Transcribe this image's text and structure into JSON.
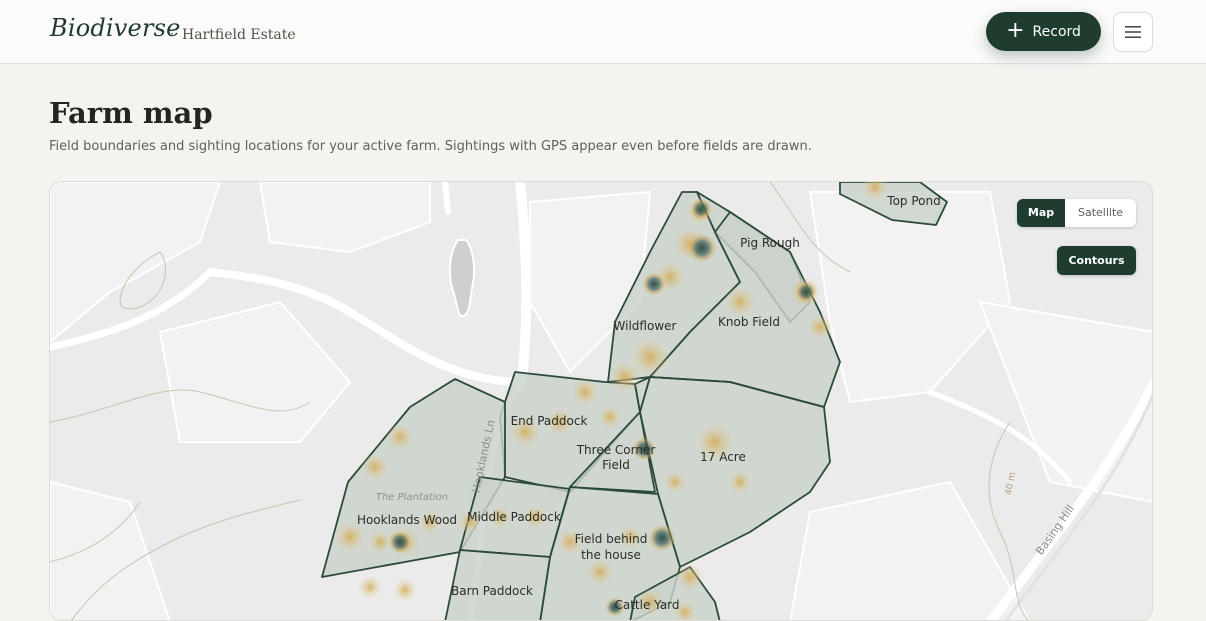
{
  "header": {
    "logo": "Biodiverse",
    "separator": "·",
    "farm_name": "Hartfield Estate",
    "record_label": "Record",
    "record_icon": "plus-icon",
    "menu_icon": "hamburger-menu-icon"
  },
  "page": {
    "title": "Farm map",
    "subtitle": "Field boundaries and sighting locations for your active farm. Sightings with GPS appear even before fields are drawn."
  },
  "map": {
    "toggle": {
      "map_label": "Map",
      "satellite_label": "Satellite",
      "selected": "Map"
    },
    "contours_label": "Contours",
    "fields": [
      "Top Pond",
      "Pig Rough",
      "Wildflower",
      "Knob Field",
      "End Paddock",
      "Three Corner Field",
      "17 Acre",
      "Hooklands Wood",
      "Middle Paddock",
      "Field behind the house",
      "Barn Paddock",
      "Cattle Yard"
    ],
    "field_labels": {
      "top_pond": "Top Pond",
      "pig_rough": "Pig Rough",
      "wildflower": "Wildflower",
      "knob_field": "Knob Field",
      "end_paddock": "End Paddock",
      "three_corner_1": "Three Corner",
      "three_corner_2": "Field",
      "seventeen_acre": "17 Acre",
      "hooklands_wood": "Hooklands Wood",
      "middle_paddock": "Middle Paddock",
      "field_behind_1": "Field behind",
      "field_behind_2": "the house",
      "barn_paddock": "Barn Paddock",
      "cattle_yard": "Cattle Yard"
    },
    "place_labels": {
      "plantation": "The Plantation",
      "hooklands_ln": "Hooklands Ln",
      "basing_hill": "Basing Hill",
      "contour_40m": "40 m"
    },
    "colors": {
      "field_fill": "#c9d2cb",
      "field_stroke": "#2b4a38",
      "heat": "#d8b56a",
      "hotspot": "#2c4f47"
    }
  }
}
